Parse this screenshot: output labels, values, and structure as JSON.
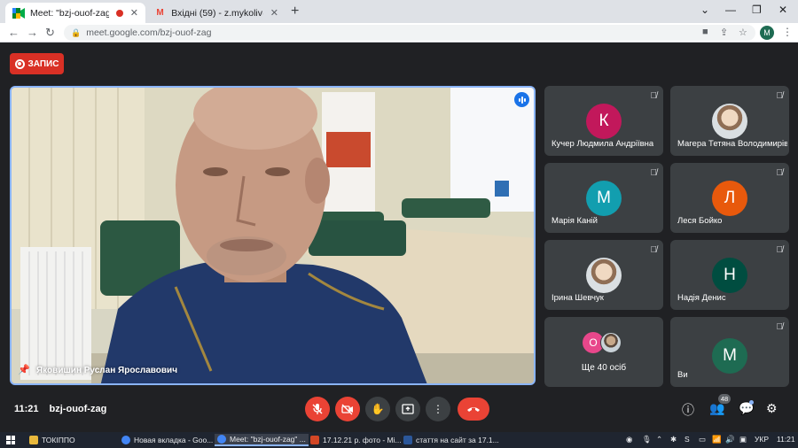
{
  "tabs": [
    {
      "title": "Meet: \"bzj-ouof-zag\"",
      "favicon": "meet-icon",
      "recording": true,
      "close": "✕"
    },
    {
      "title": "Вхідні (59) - z.mykoliv@ippo.edu",
      "favicon": "gmail-icon",
      "close": "✕"
    }
  ],
  "new_tab": "+",
  "window_controls": [
    "⌄",
    "—",
    "❐",
    "✕"
  ],
  "address": {
    "url": "meet.google.com/bzj-ouof-zag",
    "profile_initial": "M"
  },
  "record_button": "ЗАПИС",
  "main_speaker": {
    "name": "Яковишин Руслан Ярославович"
  },
  "participants": [
    {
      "name": "Кучер Людмила Андріївна",
      "initial": "К",
      "color": "#c2185b",
      "photo": false
    },
    {
      "name": "Магера Тетяна Володимирівна",
      "initial": "",
      "color": "#8a8a8a",
      "photo": true
    },
    {
      "name": "Марія Каній",
      "initial": "М",
      "color": "#129eaf",
      "photo": false
    },
    {
      "name": "Леся Бойко",
      "initial": "Л",
      "color": "#e8590c",
      "photo": false
    },
    {
      "name": "Ірина Шевчук",
      "initial": "",
      "color": "#8a8a8a",
      "photo": true
    },
    {
      "name": "Надія Денис",
      "initial": "Н",
      "color": "#004d40",
      "photo": false
    },
    {
      "name": "Ви",
      "initial": "М",
      "color": "#1e6b52",
      "photo": false
    }
  ],
  "more_tile": {
    "text": "Ще 40 осіб",
    "initial": "О"
  },
  "bottom_bar": {
    "time": "11:21",
    "meeting_code": "bzj-ouof-zag",
    "participants_count": "48"
  },
  "taskbar": {
    "items": [
      "ТОКІППО",
      "Новая вкладка - Goo...",
      "Meet: \"bzj-ouof-zag\" ...",
      "17.12.21 р. фото - Mi...",
      "стаття на сайт за 17.1..."
    ],
    "language": "УКР",
    "clock": "11:21"
  }
}
